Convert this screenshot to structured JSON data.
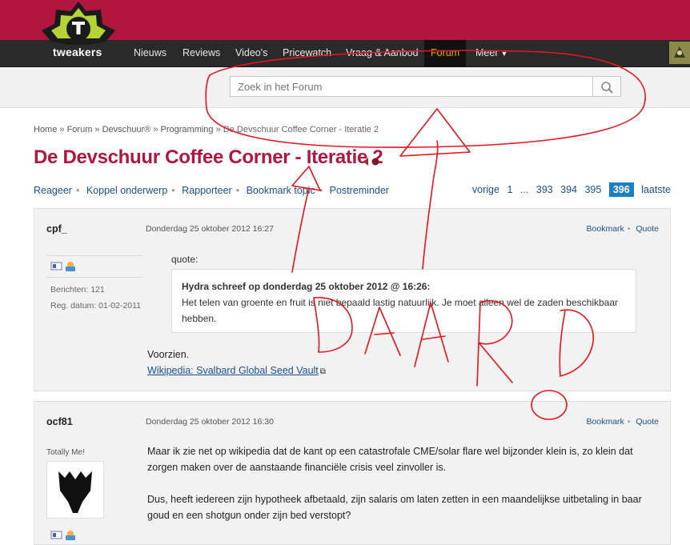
{
  "brand": {
    "logo_letter": "T",
    "logo_word": "tweakers",
    "accent": "#b0163e",
    "nav_active": "#f0a400"
  },
  "nav": {
    "items": [
      "Nieuws",
      "Reviews",
      "Video's",
      "Pricewatch",
      "Vraag & Aanbod",
      "Forum",
      "Meer"
    ],
    "active": "Forum"
  },
  "search": {
    "placeholder": "Zoek in het Forum",
    "icon": "search-icon"
  },
  "breadcrumb": [
    "Home",
    "Forum",
    "Devschuur®",
    "Programming",
    "De Devschuur Coffee Corner - Iteratie 2"
  ],
  "page_title": "De Devschuur Coffee Corner - Iteratie 2",
  "actions": [
    "Reageer",
    "Koppel onderwerp",
    "Rapporteer",
    "Bookmark topic",
    "Postreminder"
  ],
  "pager": {
    "prev": "vorige",
    "first": "1",
    "ellipsis": "...",
    "pages": [
      "393",
      "394",
      "395"
    ],
    "current": "396",
    "last": "laatste"
  },
  "posts": [
    {
      "user": "cpf_",
      "date": "Donderdag 25 oktober 2012 16:27",
      "tools": [
        "Bookmark",
        "Quote"
      ],
      "meta": [
        "Berichten: 121",
        "Reg. datum: 01-02-2011"
      ],
      "quote_label": "quote:",
      "quote_head": "Hydra schreef op donderdag 25 oktober 2012 @ 16:26:",
      "quote_body": "Het telen van groente en fruit is niet bepaald lastig natuurlijk. Je moet alleen wel de zaden beschikbaar hebben.",
      "text": "Voorzien.",
      "link": "Wikipedia: Svalbard Global Seed Vault"
    },
    {
      "user": "ocf81",
      "date": "Donderdag 25 oktober 2012 16:30",
      "tools": [
        "Bookmark",
        "Quote"
      ],
      "tagline": "Totally Me!",
      "paragraph1": "Maar ik zie net op wikipedia dat de kant op een catastrofale CME/solar flare wel bijzonder klein is, zo klein dat zorgen maken over de aanstaande financiële crisis veel zinvoller is.",
      "paragraph2": "Dus, heeft iedereen zijn hypotheek afbetaald, zijn salaris om laten zetten in een maandelijkse uitbetaling in baar goud en een shotgun onder zijn bed verstopt?"
    }
  ],
  "annotation": {
    "text": "DAAR!",
    "color": "#e8141e"
  }
}
